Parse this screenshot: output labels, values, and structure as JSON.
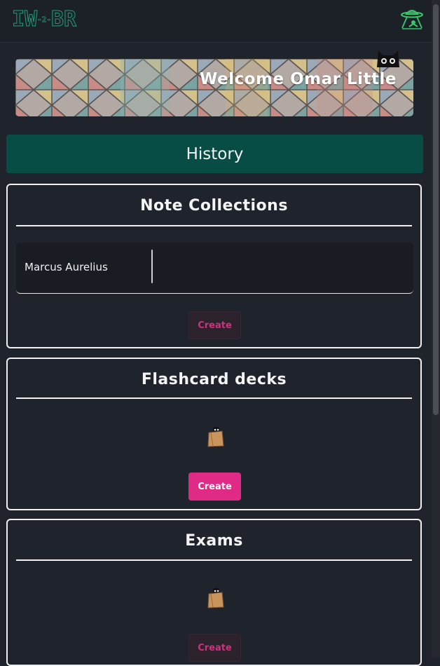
{
  "header": {
    "logo_main_left": "IW",
    "logo_small": "-2-",
    "logo_main_right": "BR",
    "logo_icon": "ufo-icon"
  },
  "banner": {
    "welcome_text": "Welcome Omar Little",
    "mascot_icon": "cat-icon"
  },
  "history_label": "History",
  "note_collections": {
    "title": "Note Collections",
    "items": [
      {
        "label": "Marcus Aurelius"
      }
    ],
    "create_label": "Create"
  },
  "flashcard_decks": {
    "title": "Flashcard decks",
    "empty_icon": "bag-icon",
    "create_label": "Create"
  },
  "exams": {
    "title": "Exams",
    "empty_icon": "bag-icon",
    "create_label": "Create"
  },
  "colors": {
    "background": "#1f232b",
    "accent_teal": "#084c46",
    "logo_green": "#1fa07b",
    "create_pink": "#df2a86"
  }
}
